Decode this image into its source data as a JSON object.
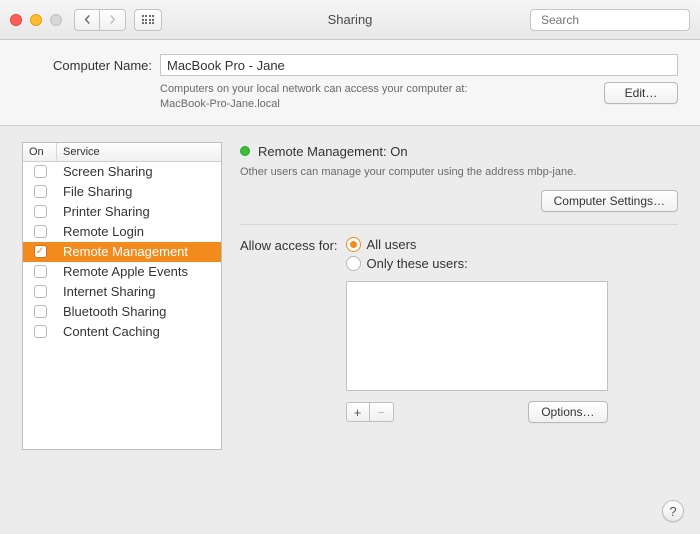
{
  "window": {
    "title": "Sharing",
    "search_placeholder": "Search"
  },
  "computerName": {
    "label": "Computer Name:",
    "value": "MacBook Pro - Jane",
    "subtext_a": "Computers on your local network can access your computer at:",
    "subtext_b": "MacBook-Pro-Jane.local",
    "edit_label": "Edit…"
  },
  "serviceList": {
    "header_on": "On",
    "header_service": "Service",
    "items": [
      {
        "label": "Screen Sharing",
        "on": false,
        "selected": false
      },
      {
        "label": "File Sharing",
        "on": false,
        "selected": false
      },
      {
        "label": "Printer Sharing",
        "on": false,
        "selected": false
      },
      {
        "label": "Remote Login",
        "on": false,
        "selected": false
      },
      {
        "label": "Remote Management",
        "on": true,
        "selected": true
      },
      {
        "label": "Remote Apple Events",
        "on": false,
        "selected": false
      },
      {
        "label": "Internet Sharing",
        "on": false,
        "selected": false
      },
      {
        "label": "Bluetooth Sharing",
        "on": false,
        "selected": false
      },
      {
        "label": "Content Caching",
        "on": false,
        "selected": false
      }
    ]
  },
  "detail": {
    "status_title": "Remote Management: On",
    "status_desc": "Other users can manage your computer using the address mbp-jane.",
    "computer_settings_label": "Computer Settings…",
    "access_label": "Allow access for:",
    "radio_all": "All users",
    "radio_only": "Only these users:",
    "options_label": "Options…",
    "plus": "+",
    "minus": "−"
  },
  "help_label": "?"
}
